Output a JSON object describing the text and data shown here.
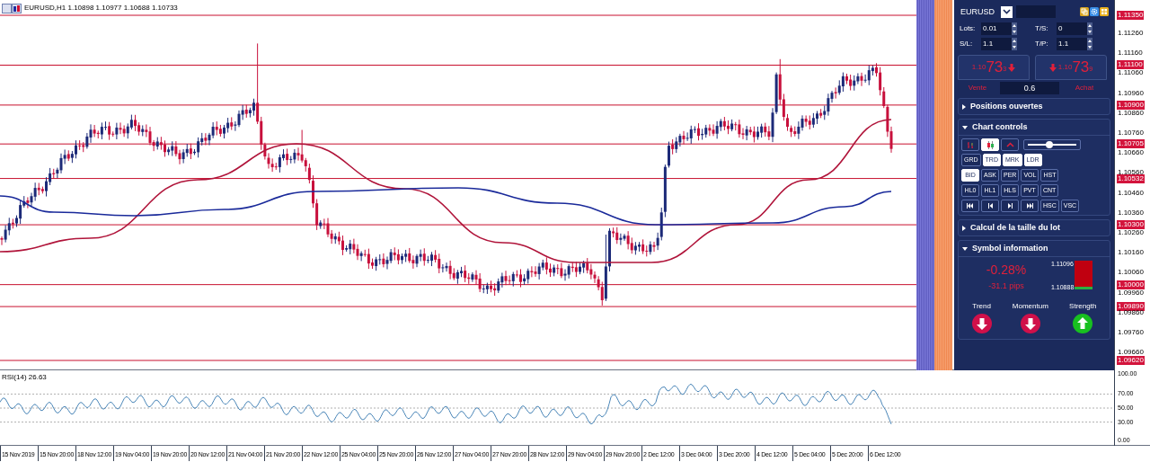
{
  "chart": {
    "title": "EURUSD,H1  1.10898 1.10977 1.10688 1.10733"
  },
  "price_axis": [
    {
      "label": "1.11350",
      "highlighted": true
    },
    {
      "label": "1.11260",
      "highlighted": false
    },
    {
      "label": "1.11160",
      "highlighted": false
    },
    {
      "label": "1.11100",
      "highlighted": true
    },
    {
      "label": "1.11060",
      "highlighted": false
    },
    {
      "label": "1.10960",
      "highlighted": false
    },
    {
      "label": "1.10900",
      "highlighted": true
    },
    {
      "label": "1.10860",
      "highlighted": false
    },
    {
      "label": "1.10760",
      "highlighted": false
    },
    {
      "label": "1.10705",
      "highlighted": true
    },
    {
      "label": "1.10660",
      "highlighted": false
    },
    {
      "label": "1.10560",
      "highlighted": false
    },
    {
      "label": "1.10532",
      "highlighted": true
    },
    {
      "label": "1.10460",
      "highlighted": false
    },
    {
      "label": "1.10360",
      "highlighted": false
    },
    {
      "label": "1.10300",
      "highlighted": true
    },
    {
      "label": "1.10260",
      "highlighted": false
    },
    {
      "label": "1.10160",
      "highlighted": false
    },
    {
      "label": "1.10060",
      "highlighted": false
    },
    {
      "label": "1.10000",
      "highlighted": true
    },
    {
      "label": "1.09960",
      "highlighted": false
    },
    {
      "label": "1.09890",
      "highlighted": true
    },
    {
      "label": "1.09860",
      "highlighted": false
    },
    {
      "label": "1.09760",
      "highlighted": false
    },
    {
      "label": "1.09660",
      "highlighted": false
    },
    {
      "label": "1.09620",
      "highlighted": true
    }
  ],
  "rsi": {
    "label": "RSI(14) 26.63",
    "axis": [
      "100.00",
      "70.00",
      "50.00",
      "30.00",
      "0.00"
    ]
  },
  "time_axis": [
    "15 Nov 2019",
    "15 Nov 20:00",
    "18 Nov 12:00",
    "19 Nov 04:00",
    "19 Nov 20:00",
    "20 Nov 12:00",
    "21 Nov 04:00",
    "21 Nov 20:00",
    "22 Nov 12:00",
    "25 Nov 04:00",
    "25 Nov 20:00",
    "26 Nov 12:00",
    "27 Nov 04:00",
    "27 Nov 20:00",
    "28 Nov 12:00",
    "29 Nov 04:00",
    "29 Nov 20:00",
    "2 Dec 12:00",
    "3 Dec 04:00",
    "3 Dec 20:00",
    "4 Dec 12:00",
    "5 Dec 04:00",
    "5 Dec 20:00",
    "6 Dec 12:00"
  ],
  "panel": {
    "symbol": "EURUSD",
    "fields": [
      {
        "label": "Lots:",
        "value": "0.01"
      },
      {
        "label": "T/S:",
        "value": "0"
      },
      {
        "label": "S/L:",
        "value": "1.1"
      },
      {
        "label": "T/P:",
        "value": "1.1"
      }
    ],
    "sell": {
      "prefix": "1.10",
      "big": "73",
      "suffix": "3",
      "label": "Vente"
    },
    "spread": "0.6",
    "buy": {
      "prefix": "1.10",
      "big": "73",
      "suffix": "9",
      "label": "Achat"
    },
    "sections": [
      {
        "kind": "positions",
        "title": "Positions ouvertes",
        "expanded": false
      },
      {
        "kind": "chart_controls",
        "title": "Chart controls",
        "expanded": true,
        "slider": {
          "level": 0.45
        },
        "rows": [
          [
            {
              "kind": "bars",
              "selected": false
            },
            {
              "kind": "candles",
              "selected": true
            },
            {
              "kind": "line",
              "selected": false
            }
          ],
          [
            {
              "kind": "text",
              "label": "GRD",
              "selected": false
            },
            {
              "kind": "text",
              "label": "TRD",
              "selected": true
            },
            {
              "kind": "text",
              "label": "MRK",
              "selected": true
            },
            {
              "kind": "text",
              "label": "LDR",
              "selected": true
            }
          ],
          [
            {
              "kind": "text",
              "label": "BID",
              "selected": true
            },
            {
              "kind": "text",
              "label": "ASK",
              "selected": false
            },
            {
              "kind": "text",
              "label": "PER",
              "selected": false
            },
            {
              "kind": "text",
              "label": "VOL",
              "selected": false
            },
            {
              "kind": "text",
              "label": "HST",
              "selected": false
            }
          ],
          [
            {
              "kind": "text",
              "label": "HL0",
              "selected": false
            },
            {
              "kind": "text",
              "label": "HL1",
              "selected": false
            },
            {
              "kind": "text",
              "label": "HLS",
              "selected": false
            },
            {
              "kind": "text",
              "label": "PVT",
              "selected": false
            },
            {
              "kind": "text",
              "label": "CNT",
              "selected": false
            }
          ],
          [
            {
              "kind": "first",
              "selected": false
            },
            {
              "kind": "prev",
              "selected": false
            },
            {
              "kind": "next",
              "selected": false
            },
            {
              "kind": "last",
              "selected": false
            },
            {
              "kind": "text",
              "label": "HSC",
              "selected": false
            },
            {
              "kind": "text",
              "label": "VSC",
              "selected": false
            }
          ]
        ]
      },
      {
        "kind": "lot_calc",
        "title": "Calcul de la taille du lot",
        "expanded": false
      },
      {
        "kind": "symbol_info",
        "title": "Symbol information",
        "expanded": true,
        "change": "-0.28%",
        "pips": "-31.1 pips",
        "high": "1.11096",
        "low": "1.10888",
        "signals": [
          {
            "label": "Trend",
            "kind": "down"
          },
          {
            "label": "Momentum",
            "kind": "down"
          },
          {
            "label": "Strength",
            "kind": "up"
          }
        ]
      }
    ]
  }
}
